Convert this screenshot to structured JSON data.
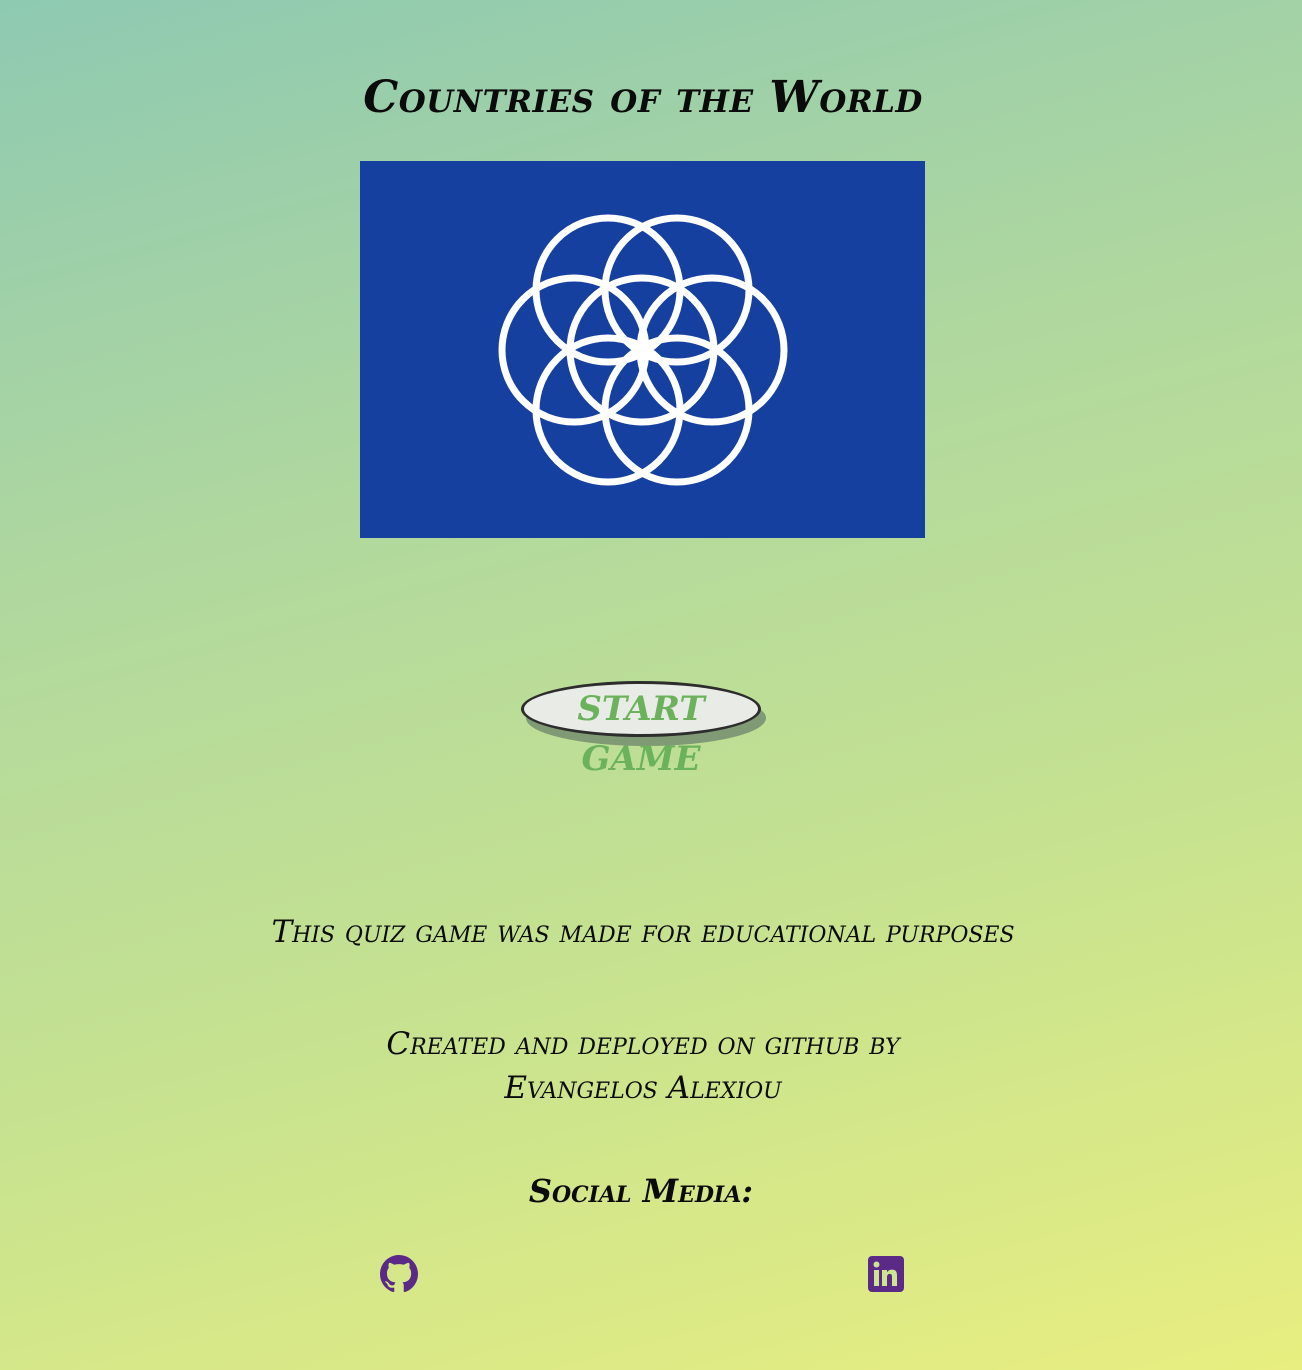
{
  "header": {
    "title": "Countries of the World"
  },
  "flag": {
    "name": "flag-of-planet-earth",
    "background_color": "#1640a0",
    "ring_color": "#ffffff"
  },
  "game": {
    "start_label": "START GAME",
    "start_text_color": "#6cb25c"
  },
  "footer": {
    "note": "This quiz game was made for educational purposes",
    "credit_line1": "Created and deployed on github by",
    "credit_line2": "Evangelos Alexiou",
    "social_heading": "Social Media:",
    "icon_color": "#5b2a86",
    "links": [
      {
        "icon": "github-icon"
      },
      {
        "icon": "linkedin-icon"
      }
    ]
  }
}
